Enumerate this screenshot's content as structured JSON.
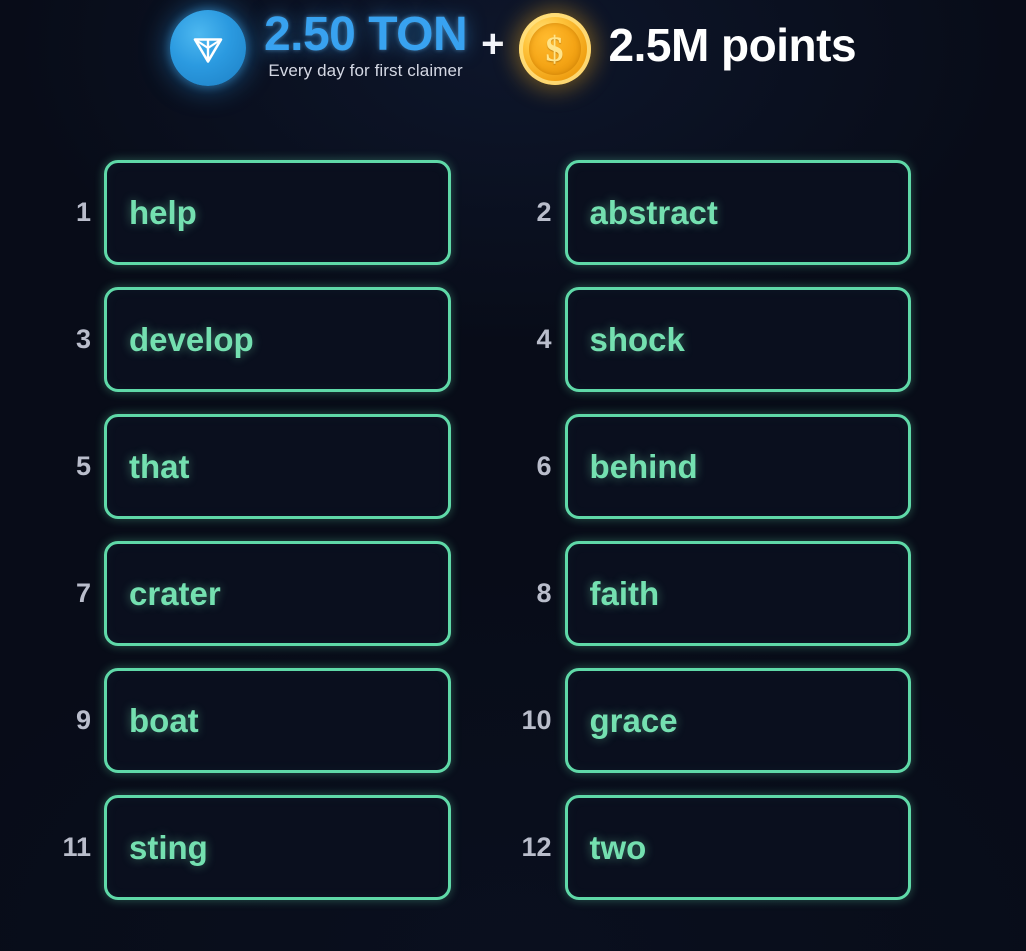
{
  "header": {
    "ton_icon": "ton-diamond-icon",
    "ton_amount": "2.50 TON",
    "ton_subtitle": "Every day for first claimer",
    "plus": "+",
    "coin_icon": "gold-coin-dollar-icon",
    "coin_symbol": "$",
    "points_amount": "2.5M points"
  },
  "colors": {
    "background": "#080c18",
    "ton_blue": "#38a2f0",
    "coin_gold": "#f5a516",
    "box_border_green": "#5fd9a8",
    "word_text_green": "#74e0b0",
    "index_gray": "#b9bdcb",
    "points_white": "#ffffff"
  },
  "seed_phrase": {
    "count": 12,
    "words": [
      {
        "index": "1",
        "word": "help"
      },
      {
        "index": "2",
        "word": "abstract"
      },
      {
        "index": "3",
        "word": "develop"
      },
      {
        "index": "4",
        "word": "shock"
      },
      {
        "index": "5",
        "word": "that"
      },
      {
        "index": "6",
        "word": "behind"
      },
      {
        "index": "7",
        "word": "crater"
      },
      {
        "index": "8",
        "word": "faith"
      },
      {
        "index": "9",
        "word": "boat"
      },
      {
        "index": "10",
        "word": "grace"
      },
      {
        "index": "11",
        "word": "sting"
      },
      {
        "index": "12",
        "word": "two"
      }
    ]
  }
}
